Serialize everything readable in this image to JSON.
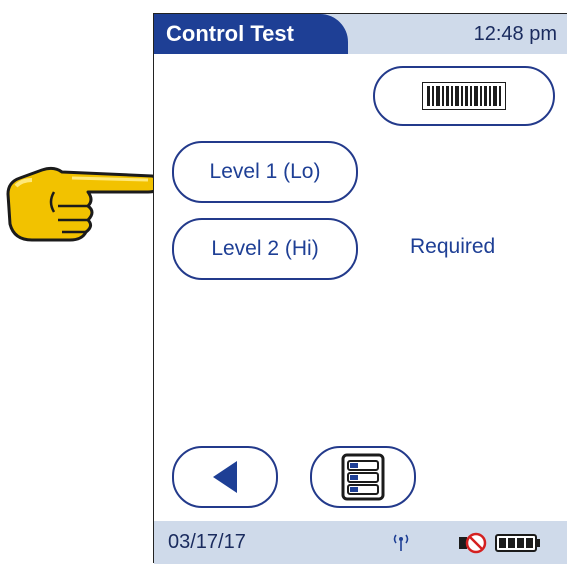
{
  "header": {
    "title": "Control Test",
    "time": "12:48 pm"
  },
  "buttons": {
    "level1_label": "Level 1 (Lo)",
    "level2_label": "Level 2 (Hi)"
  },
  "status": {
    "level2_required": "Required"
  },
  "footer": {
    "date": "03/17/17"
  },
  "icons": {
    "barcode": "barcode-icon",
    "back": "back-arrow-icon",
    "menu": "list-menu-icon",
    "wireless": "wireless-icon",
    "no_power": "no-ac-power-icon",
    "battery": "battery-icon",
    "pointer": "pointing-hand-icon"
  },
  "colors": {
    "primary": "#1e3f95",
    "bar_bg": "#cfdaea"
  }
}
